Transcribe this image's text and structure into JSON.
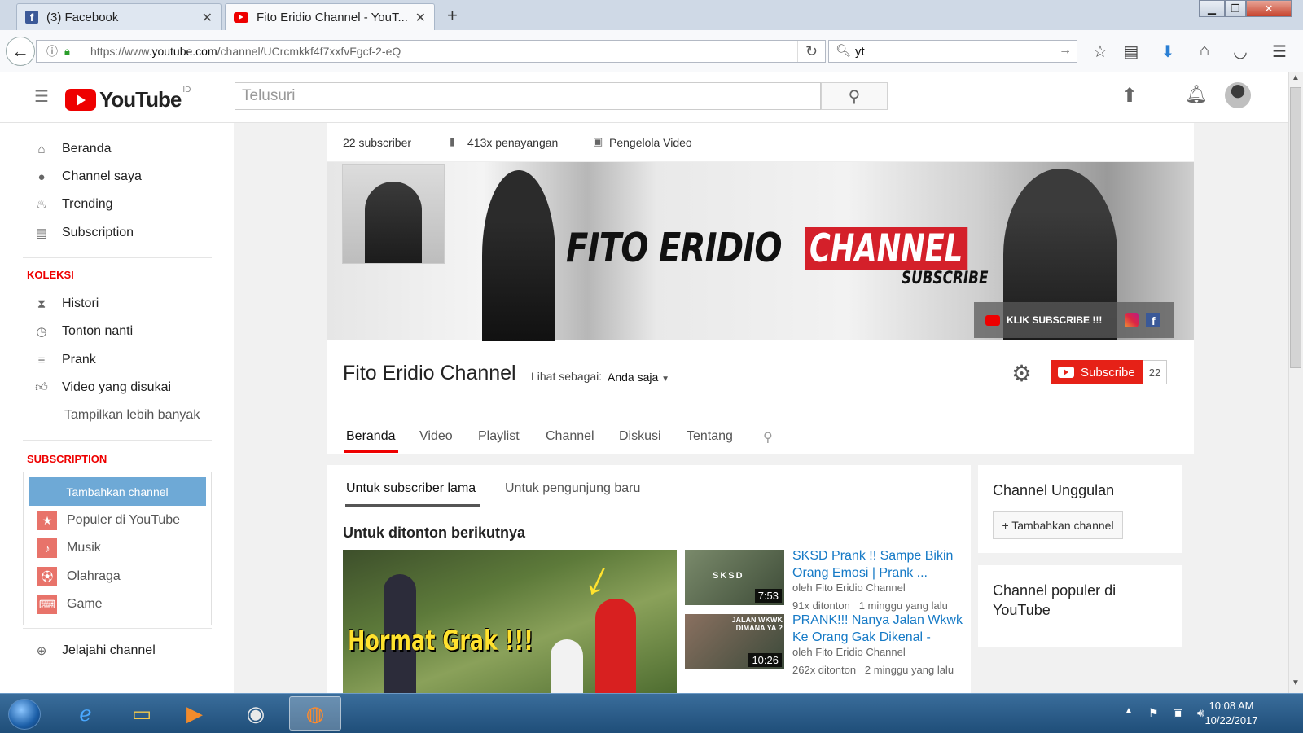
{
  "browser": {
    "tabs": [
      {
        "label": "(3) Facebook"
      },
      {
        "label": "Fito Eridio Channel - YouT..."
      }
    ],
    "url_prefix": "https://www.",
    "url_domain": "youtube.com",
    "url_path": "/channel/UCrcmkkf4f7xxfvFgcf-2-eQ",
    "search_value": "yt"
  },
  "youtube": {
    "logo_text": "YouTube",
    "region": "ID",
    "search_placeholder": "Telusuri"
  },
  "sidebar": {
    "main_items": [
      {
        "label": "Beranda",
        "icon": "home-icon"
      },
      {
        "label": "Channel saya",
        "icon": "account-icon"
      },
      {
        "label": "Trending",
        "icon": "flame-icon"
      },
      {
        "label": "Subscription",
        "icon": "subscriptions-icon"
      }
    ],
    "koleksi_header": "KOLEKSI",
    "koleksi_items": [
      {
        "label": "Histori",
        "icon": "hourglass-icon"
      },
      {
        "label": "Tonton nanti",
        "icon": "clock-icon"
      },
      {
        "label": "Prank",
        "icon": "playlist-icon"
      },
      {
        "label": "Video yang disukai",
        "icon": "thumbs-up-icon"
      }
    ],
    "show_more": "Tampilkan lebih banyak",
    "subscription_header": "SUBSCRIPTION",
    "add_channel": "Tambahkan channel",
    "subscription_items": [
      {
        "label": "Populer di YouTube",
        "icon": "star-icon"
      },
      {
        "label": "Musik",
        "icon": "music-icon"
      },
      {
        "label": "Olahraga",
        "icon": "sports-icon"
      },
      {
        "label": "Game",
        "icon": "gamepad-icon"
      }
    ],
    "browse_channels": "Jelajahi channel"
  },
  "channel": {
    "stats": {
      "subscribers": "22 subscriber",
      "views": "413x penayangan",
      "video_manager": "Pengelola Video"
    },
    "banner": {
      "title_black": "FITO ERIDIO",
      "title_red": "CHANNEL",
      "subscribe_text": "SUBSCRIBE",
      "cta": "KLIK SUBSCRIBE !!!"
    },
    "name": "Fito Eridio Channel",
    "view_as_label": "Lihat sebagai:",
    "view_as_value": "Anda saja",
    "subscribe_label": "Subscribe",
    "subscribe_count": "22",
    "tabs": [
      "Beranda",
      "Video",
      "Playlist",
      "Channel",
      "Diskusi",
      "Tentang"
    ]
  },
  "content": {
    "subtabs": [
      "Untuk subscriber lama",
      "Untuk pengunjung baru"
    ],
    "section_title": "Untuk ditonton berikutnya",
    "main_thumb_text": "Hormat Grak !!!",
    "videos": [
      {
        "title": "SKSD Prank !! Sampe Bikin Orang Emosi | Prank ...",
        "thumb_text": "SKSD",
        "author": "oleh Fito Eridio Channel",
        "views": "91x ditonton",
        "age": "1 minggu yang lalu",
        "duration": "7:53"
      },
      {
        "title": "PRANK!!! Nanya Jalan Wkwk Ke Orang Gak Dikenal - Prar...",
        "thumb_text": "JALAN WKWK DIMANA YA ?",
        "author": "oleh Fito Eridio Channel",
        "views": "262x ditonton",
        "age": "2 minggu yang lalu",
        "duration": "10:26"
      }
    ]
  },
  "right": {
    "featured_title": "Channel Unggulan",
    "add_channel_btn": "+ Tambahkan channel",
    "popular_title": "Channel populer di YouTube"
  },
  "taskbar": {
    "time": "10:08 AM",
    "date": "10/22/2017"
  },
  "colors": {
    "youtube_red": "#e62117",
    "link_blue": "#167ac6",
    "sidebar_accent": "#6ea9d6"
  }
}
